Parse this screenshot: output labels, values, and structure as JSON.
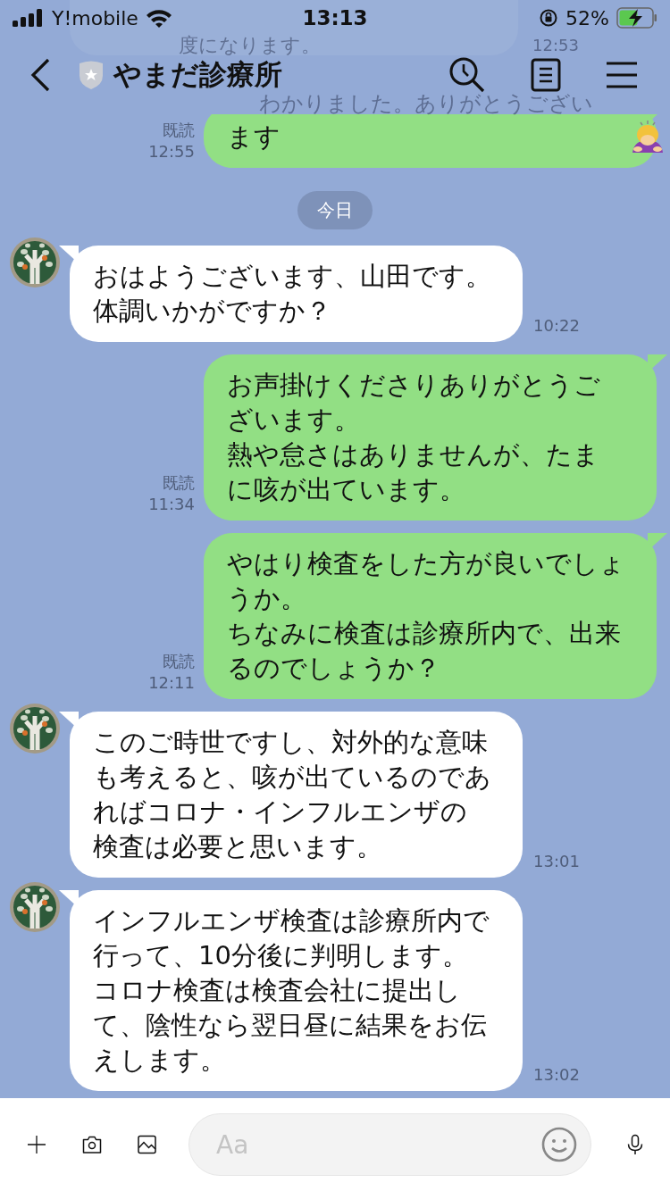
{
  "status_bar": {
    "carrier": "Y!mobile",
    "time": "13:13",
    "battery": "52%"
  },
  "behind_header": {
    "incoming_text": "度になります。",
    "incoming_time": "12:53",
    "outgoing_text": "わかりました。ありがとうござい"
  },
  "header": {
    "title": "やまだ診療所"
  },
  "messages": [
    {
      "kind": "outgoing",
      "paragraphs": [
        "ます"
      ],
      "has_emoji": true,
      "read": "既読",
      "time": "12:55"
    },
    {
      "kind": "date",
      "text": "今日"
    },
    {
      "kind": "incoming",
      "paragraphs": [
        "おはようございます、山田です。",
        "体調いかがですか？"
      ],
      "time": "10:22"
    },
    {
      "kind": "outgoing",
      "paragraphs": [
        "お声掛けくださりありがとうございます。",
        "熱や怠さはありませんが、たまに咳が出ています。"
      ],
      "read": "既読",
      "time": "11:34"
    },
    {
      "kind": "outgoing",
      "paragraphs": [
        "やはり検査をした方が良いでしょうか。",
        "ちなみに検査は診療所内で、出来るのでしょうか？"
      ],
      "read": "既読",
      "time": "12:11"
    },
    {
      "kind": "incoming",
      "paragraphs": [
        "このご時世ですし、対外的な意味も考えると、咳が出ているのであればコロナ・インフルエンザの検査は必要と思います。"
      ],
      "time": "13:01"
    },
    {
      "kind": "incoming",
      "paragraphs": [
        "インフルエンザ検査は診療所内で行って、10分後に判明します。",
        "コロナ検査は検査会社に提出して、陰性なら翌日昼に結果をお伝えします。"
      ],
      "time": "13:02"
    }
  ],
  "input": {
    "placeholder": "Aa"
  }
}
